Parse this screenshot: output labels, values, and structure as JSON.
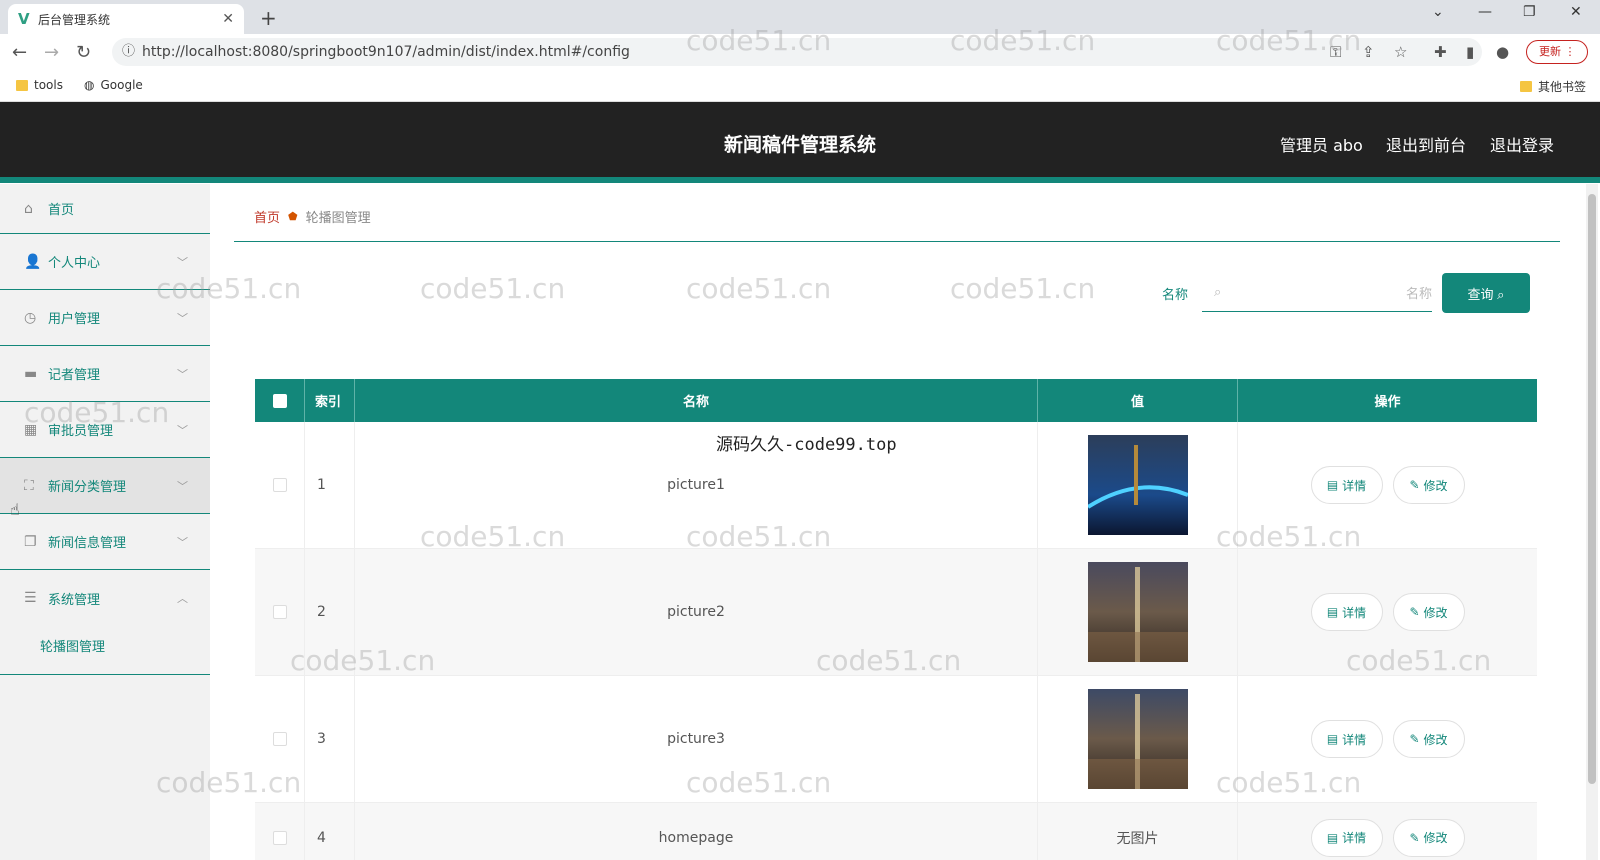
{
  "browser": {
    "tab_title": "后台管理系统",
    "url": "http://localhost:8080/springboot9n107/admin/dist/index.html#/config",
    "update_label": "更新",
    "bookmarks": [
      "tools",
      "Google"
    ],
    "other_bookmarks": "其他书签"
  },
  "header": {
    "title": "新闻稿件管理系统",
    "admin_label": "管理员 abo",
    "exit_front": "退出到前台",
    "logout": "退出登录"
  },
  "sidebar": {
    "items": [
      {
        "label": "首页"
      },
      {
        "label": "个人中心"
      },
      {
        "label": "用户管理"
      },
      {
        "label": "记者管理"
      },
      {
        "label": "审批员管理"
      },
      {
        "label": "新闻分类管理"
      },
      {
        "label": "新闻信息管理"
      },
      {
        "label": "系统管理"
      }
    ],
    "submenu": "轮播图管理"
  },
  "breadcrumb": {
    "home": "首页",
    "current": "轮播图管理"
  },
  "search": {
    "label": "名称",
    "placeholder": "名称",
    "button": "查询"
  },
  "table": {
    "headers": [
      "索引",
      "名称",
      "值",
      "操作"
    ],
    "rows": [
      {
        "index": "1",
        "name": "picture1",
        "value": ""
      },
      {
        "index": "2",
        "name": "picture2",
        "value": ""
      },
      {
        "index": "3",
        "name": "picture3",
        "value": ""
      },
      {
        "index": "4",
        "name": "homepage",
        "value": "无图片"
      }
    ],
    "detail_label": "详情",
    "edit_label": "修改"
  },
  "overlay_text": "源码久久-code99.top",
  "watermark_text": "code51.cn",
  "colors": {
    "accent": "#13877a",
    "header_bg": "#222222"
  }
}
